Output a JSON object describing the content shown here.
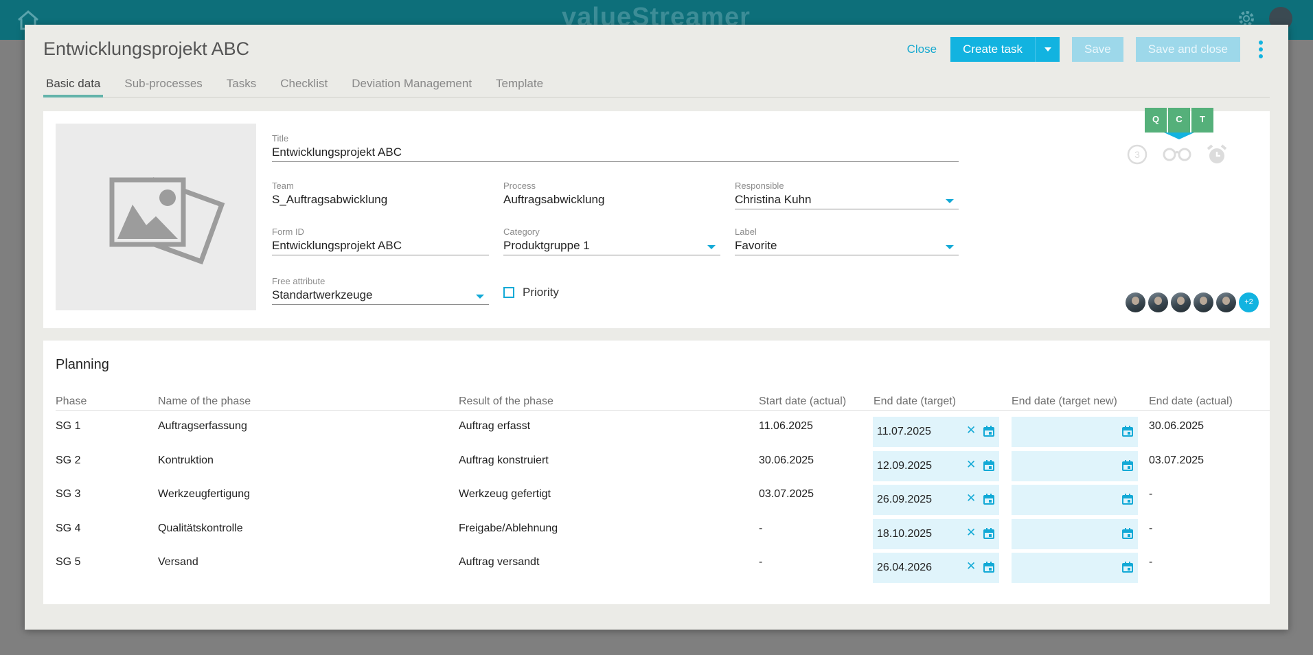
{
  "app": {
    "logo": "valueStreamer"
  },
  "modal": {
    "title": "Entwicklungsprojekt ABC",
    "actions": {
      "close": "Close",
      "create_task": "Create task",
      "save": "Save",
      "save_and_close": "Save and close"
    }
  },
  "tabs": [
    "Basic data",
    "Sub-processes",
    "Tasks",
    "Checklist",
    "Deviation Management",
    "Template"
  ],
  "basic": {
    "title_label": "Title",
    "title_value": "Entwicklungsprojekt ABC",
    "team_label": "Team",
    "team_value": "S_Auftragsabwicklung",
    "process_label": "Process",
    "process_value": "Auftragsabwicklung",
    "responsible_label": "Responsible",
    "responsible_value": "Christina Kuhn",
    "formid_label": "Form ID",
    "formid_value": "Entwicklungsprojekt ABC",
    "category_label": "Category",
    "category_value": "Produktgruppe 1",
    "label_label": "Label",
    "label_value": "Favorite",
    "free_label": "Free attribute",
    "free_value": "Standartwerkzeuge",
    "priority_label": "Priority"
  },
  "qct": [
    "Q",
    "C",
    "T"
  ],
  "status_icons": [
    "counter-3-icon",
    "glasses-icon",
    "alarm-clock-icon"
  ],
  "status_counter": "3",
  "avatars_more": "+2",
  "colors": {
    "accent": "#12b3e0",
    "qct_green": "#55b07a",
    "tab_underline": "#63b3aa",
    "header": "#0d6f7a"
  },
  "planning": {
    "title": "Planning",
    "headers": [
      "Phase",
      "Name of the phase",
      "Result of the phase",
      "Start date (actual)",
      "End date (target)",
      "End date (target new)",
      "End date (actual)"
    ],
    "rows": [
      {
        "phase": "SG 1",
        "name": "Auftragserfassung",
        "result": "Auftrag erfasst",
        "start_actual": "11.06.2025",
        "end_target": "11.07.2025",
        "end_target_new": "",
        "end_actual": "30.06.2025"
      },
      {
        "phase": "SG 2",
        "name": "Kontruktion",
        "result": "Auftrag konstruiert",
        "start_actual": "30.06.2025",
        "end_target": "12.09.2025",
        "end_target_new": "",
        "end_actual": "03.07.2025"
      },
      {
        "phase": "SG 3",
        "name": "Werkzeugfertigung",
        "result": "Werkzeug gefertigt",
        "start_actual": "03.07.2025",
        "end_target": "26.09.2025",
        "end_target_new": "",
        "end_actual": "-"
      },
      {
        "phase": "SG 4",
        "name": "Qualitätskontrolle",
        "result": "Freigabe/Ablehnung",
        "start_actual": "-",
        "end_target": "18.10.2025",
        "end_target_new": "",
        "end_actual": "-"
      },
      {
        "phase": "SG 5",
        "name": "Versand",
        "result": "Auftrag versandt",
        "start_actual": "-",
        "end_target": "26.04.2026",
        "end_target_new": "",
        "end_actual": "-"
      }
    ]
  }
}
